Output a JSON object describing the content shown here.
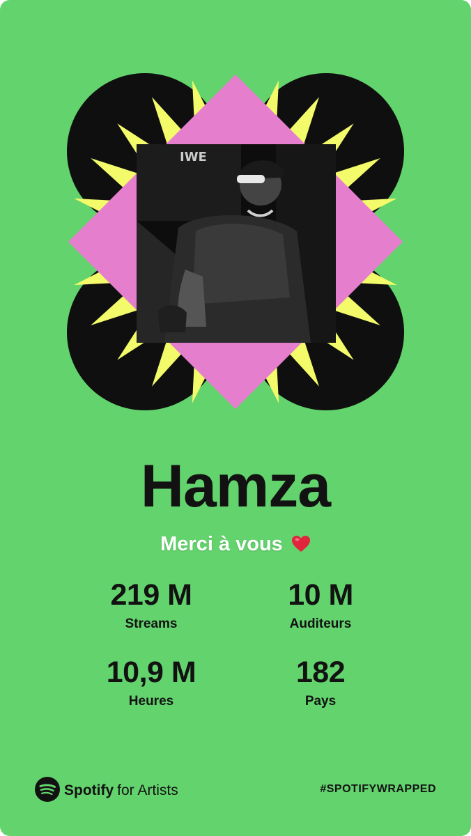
{
  "artist": {
    "name": "Hamza",
    "message": "Merci à vous"
  },
  "stats": [
    {
      "value": "219 M",
      "label": "Streams"
    },
    {
      "value": "10 M",
      "label": "Auditeurs"
    },
    {
      "value": "10,9 M",
      "label": "Heures"
    },
    {
      "value": "182",
      "label": "Pays"
    }
  ],
  "footer": {
    "brand": "Spotify",
    "brand_suffix": "for Artists",
    "hashtag": "#SPOTIFYWRAPPED"
  },
  "icons": {
    "brand_logo": "spotify-logo-icon",
    "message_emoji": "heart-icon",
    "photo": "artist-photo"
  },
  "colors": {
    "background": "#63d36d",
    "text": "#121212",
    "accent_pink": "#e57fcd",
    "accent_yellow": "#f3fb6a",
    "black": "#0f0f0f",
    "heart": "#e0253d"
  }
}
